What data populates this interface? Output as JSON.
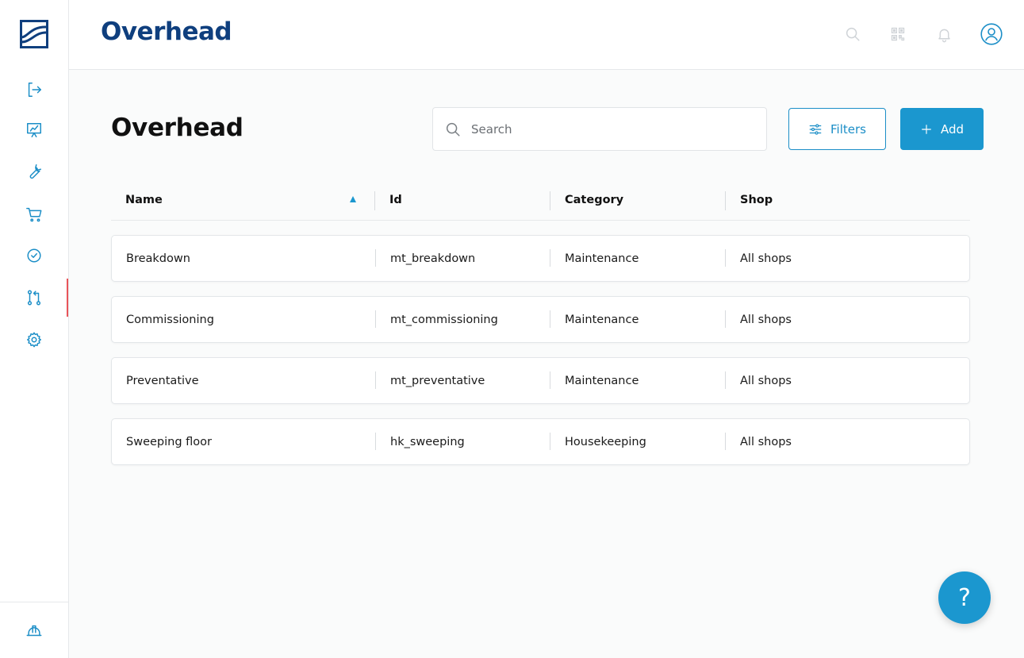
{
  "header": {
    "app_title": "Overhead"
  },
  "sidebar": {
    "items": [
      {
        "icon": "logout-icon",
        "active": false
      },
      {
        "icon": "presentation-chart-icon",
        "active": false
      },
      {
        "icon": "wrench-icon",
        "active": false
      },
      {
        "icon": "cart-icon",
        "active": false
      },
      {
        "icon": "check-circle-icon",
        "active": false
      },
      {
        "icon": "flow-branch-icon",
        "active": true
      },
      {
        "icon": "gear-icon",
        "active": false
      }
    ],
    "bottom_icon": "hard-hat-icon"
  },
  "main": {
    "title": "Overhead",
    "search": {
      "placeholder": "Search",
      "value": ""
    },
    "filters_label": "Filters",
    "add_label": "Add",
    "help_label": "?"
  },
  "table": {
    "columns": [
      "Name",
      "Id",
      "Category",
      "Shop"
    ],
    "sort": {
      "column": "Name",
      "direction": "ascending"
    },
    "rows": [
      {
        "name": "Breakdown",
        "id": "mt_breakdown",
        "category": "Maintenance",
        "shop": "All shops"
      },
      {
        "name": "Commissioning",
        "id": "mt_commissioning",
        "category": "Maintenance",
        "shop": "All shops"
      },
      {
        "name": "Preventative",
        "id": "mt_preventative",
        "category": "Maintenance",
        "shop": "All shops"
      },
      {
        "name": "Sweeping floor",
        "id": "hk_sweeping",
        "category": "Housekeeping",
        "shop": "All shops"
      }
    ]
  },
  "colors": {
    "brand": "#0f3f7e",
    "accent": "#1b97cf",
    "active_indicator": "#e8545a"
  }
}
